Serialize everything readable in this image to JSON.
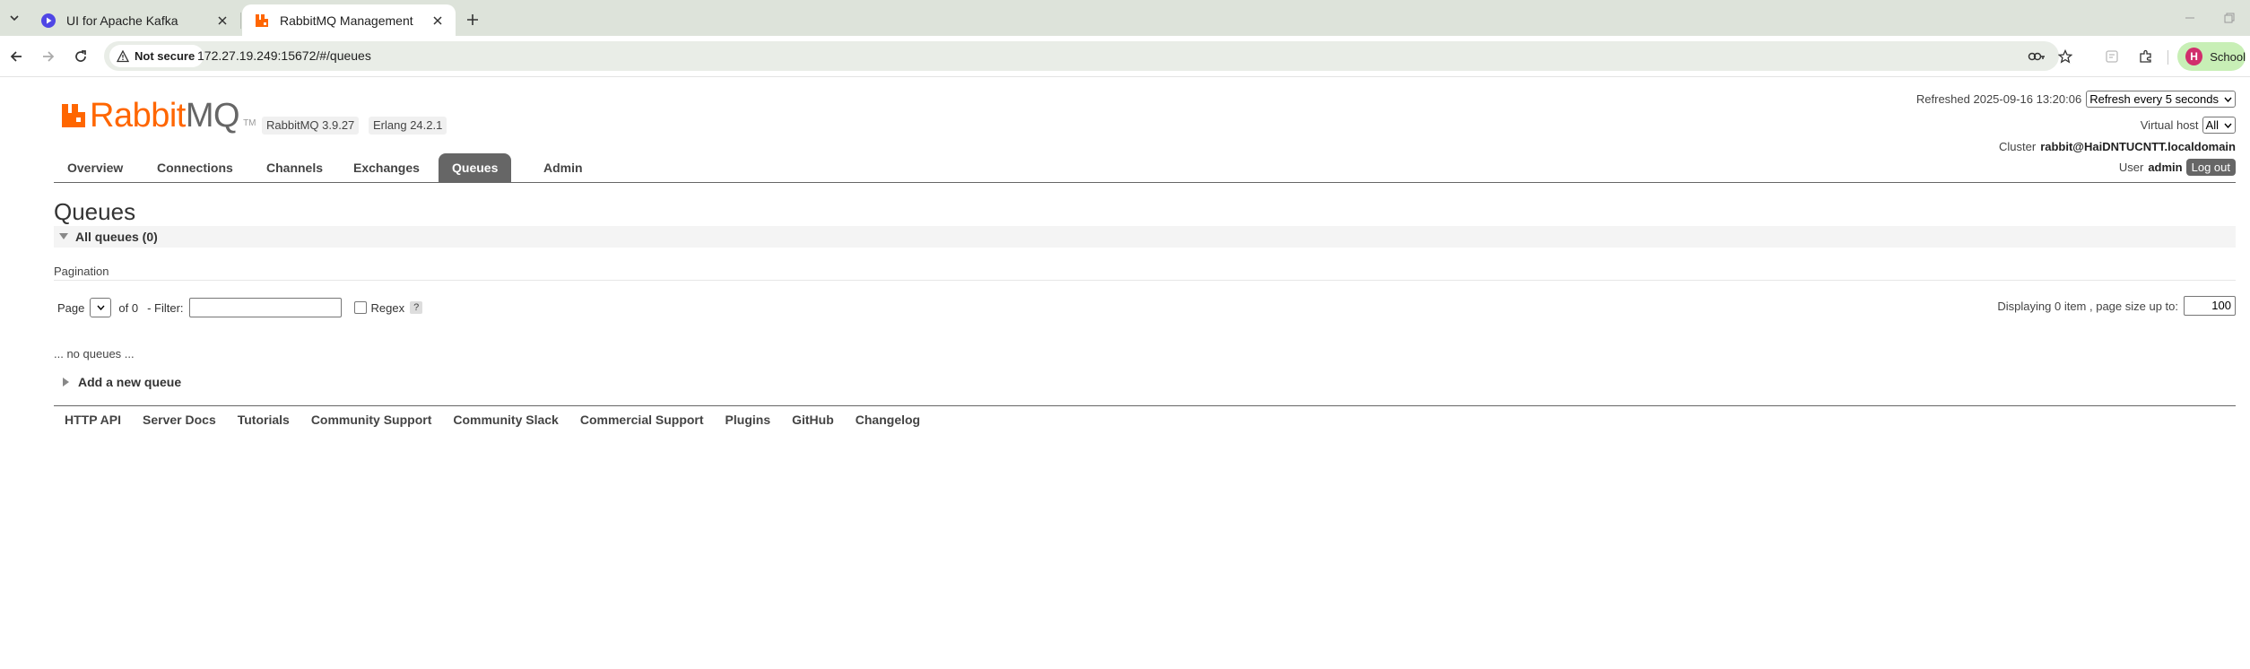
{
  "browser": {
    "tabs": [
      {
        "title": "UI for Apache Kafka",
        "favicon": "kafka-ui-icon",
        "active": false
      },
      {
        "title": "RabbitMQ Management",
        "favicon": "rabbitmq-icon",
        "active": true
      }
    ],
    "security_label": "Not secure",
    "url": "172.27.19.249:15672/#/queues",
    "profile_initial": "H",
    "profile_name": "School"
  },
  "header": {
    "logo_text_orange": "Rabbit",
    "logo_text_gray": "MQ",
    "logo_tm": "TM",
    "rabbitmq_version": "RabbitMQ 3.9.27",
    "erlang_version": "Erlang 24.2.1",
    "refreshed_label": "Refreshed 2025-09-16 13:20:06",
    "refresh_option": "Refresh every 5 seconds",
    "virtual_host_label": "Virtual host",
    "virtual_host_value": "All",
    "cluster_label": "Cluster",
    "cluster_value": "rabbit@HaiDNTUCNTT.localdomain",
    "user_label": "User",
    "user_value": "admin",
    "logout_label": "Log out"
  },
  "nav": {
    "overview": "Overview",
    "connections": "Connections",
    "channels": "Channels",
    "exchanges": "Exchanges",
    "queues": "Queues",
    "admin": "Admin",
    "active": "Queues"
  },
  "main": {
    "title": "Queues",
    "section_label": "All queues (0)",
    "pagination_title": "Pagination",
    "page_label": "Page",
    "of_label": "of 0",
    "filter_label": "- Filter:",
    "regex_label": "Regex",
    "help_label": "?",
    "displaying_label": "Displaying 0 item , page size up to:",
    "page_size": "100",
    "no_queues": "... no queues ...",
    "add_queue": "Add a new queue"
  },
  "footer": {
    "http_api": "HTTP API",
    "server_docs": "Server Docs",
    "tutorials": "Tutorials",
    "community_support": "Community Support",
    "community_slack": "Community Slack",
    "commercial_support": "Commercial Support",
    "plugins": "Plugins",
    "github": "GitHub",
    "changelog": "Changelog"
  },
  "colors": {
    "brand_orange": "#ff6600",
    "nav_active": "#666666",
    "chrome_bg": "#dde3da",
    "profile_chip": "#c8efb6"
  }
}
